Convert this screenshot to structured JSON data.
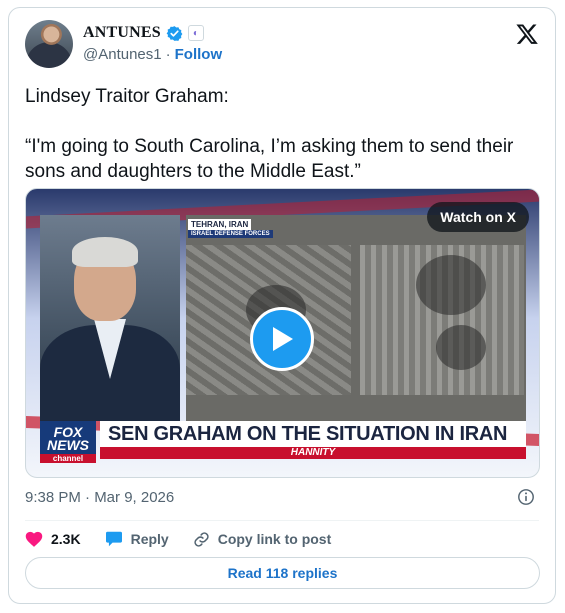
{
  "author": {
    "display_name": "ANTUNES",
    "handle": "@Antunes1",
    "separator": "·",
    "follow_label": "Follow"
  },
  "tweet": {
    "text": "Lindsey Traitor Graham:\n\n“I'm going to South Carolina, I’m asking them to send their sons and daughters to the Middle East.”"
  },
  "media": {
    "watch_label": "Watch on X",
    "location_tag": "TEHRAN, IRAN",
    "location_sub": "ISRAEL DEFENSE FORCES",
    "network_line1": "FOX",
    "network_line2": "NEWS",
    "network_line3": "channel",
    "headline": "SEN GRAHAM ON THE SITUATION IN IRAN",
    "show_name": "HANNITY"
  },
  "timestamp": "9:38 PM · Mar 9, 2026",
  "actions": {
    "like_count": "2.3K",
    "reply_label": "Reply",
    "copy_label": "Copy link to post"
  },
  "read_replies_label": "Read 118 replies",
  "colors": {
    "accent": "#1d9bf0",
    "link": "#1d73c9",
    "like": "#f91880",
    "muted": "#536471"
  },
  "icons": [
    "verified-badge-icon",
    "x-logo-icon",
    "play-icon",
    "info-icon",
    "heart-icon",
    "reply-icon",
    "link-icon"
  ]
}
